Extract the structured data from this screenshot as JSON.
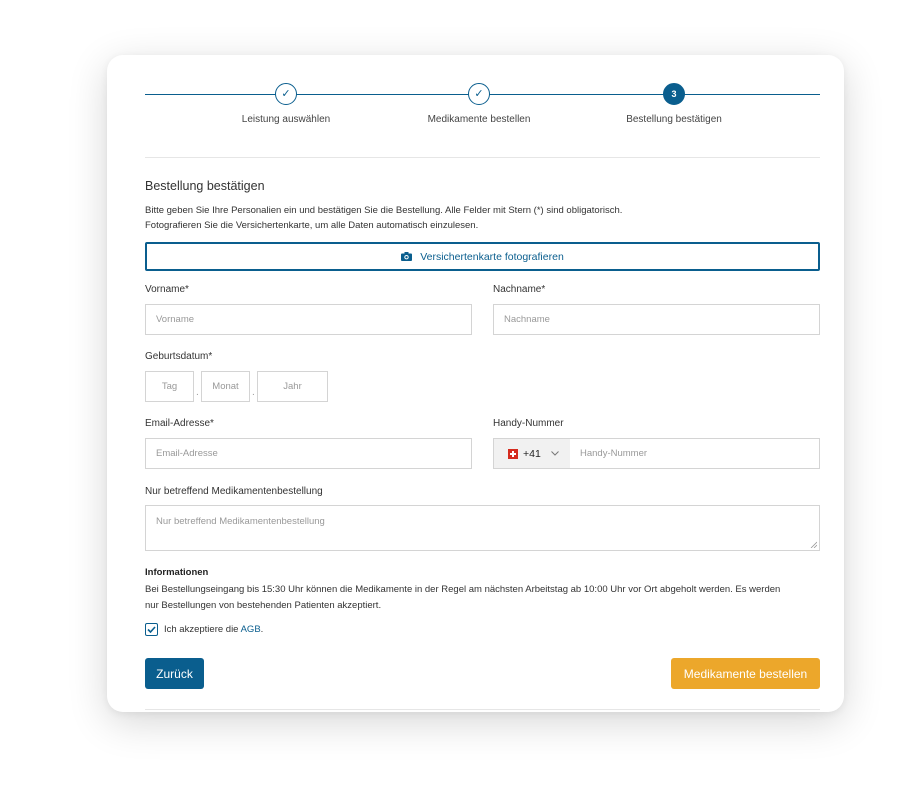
{
  "stepper": {
    "steps": [
      {
        "label": "Leistung auswählen",
        "marker": "✓"
      },
      {
        "label": "Medikamente bestellen",
        "marker": "✓"
      },
      {
        "label": "Bestellung bestätigen",
        "marker": "3"
      }
    ]
  },
  "form": {
    "title": "Bestellung bestätigen",
    "intro_line1": "Bitte geben Sie Ihre Personalien ein und bestätigen Sie die Bestellung. Alle Felder mit Stern (*) sind obligatorisch.",
    "intro_line2": "Fotografieren Sie die Versichertenkarte, um alle Daten automatisch einzulesen.",
    "photo_button": "Versichertenkarte fotografieren",
    "firstname": {
      "label": "Vorname*",
      "placeholder": "Vorname"
    },
    "lastname": {
      "label": "Nachname*",
      "placeholder": "Nachname"
    },
    "birthdate": {
      "label": "Geburtsdatum*",
      "day": "Tag",
      "month": "Monat",
      "year": "Jahr",
      "separator": "."
    },
    "email": {
      "label": "Email-Adresse*",
      "placeholder": "Email-Adresse"
    },
    "phone": {
      "label": "Handy-Nummer",
      "country_code": "+41",
      "placeholder": "Handy-Nummer"
    },
    "note": {
      "label": "Nur betreffend Medikamentenbestellung",
      "placeholder": "Nur betreffend Medikamentenbestellung"
    },
    "info": {
      "title": "Informationen",
      "line1": "Bei Bestellungseingang bis 15:30 Uhr können die Medikamente in der Regel am nächsten Arbeitstag ab 10:00 Uhr vor Ort abgeholt werden. Es werden",
      "line2": "nur Bestellungen von bestehenden Patienten akzeptiert."
    },
    "agb": {
      "text": "Ich akzeptiere die",
      "link": "AGB",
      "suffix": "."
    },
    "back_button": "Zurück",
    "order_button": "Medikamente bestellen"
  },
  "colors": {
    "primary": "#0a5e8e",
    "accent": "#eca72b"
  }
}
